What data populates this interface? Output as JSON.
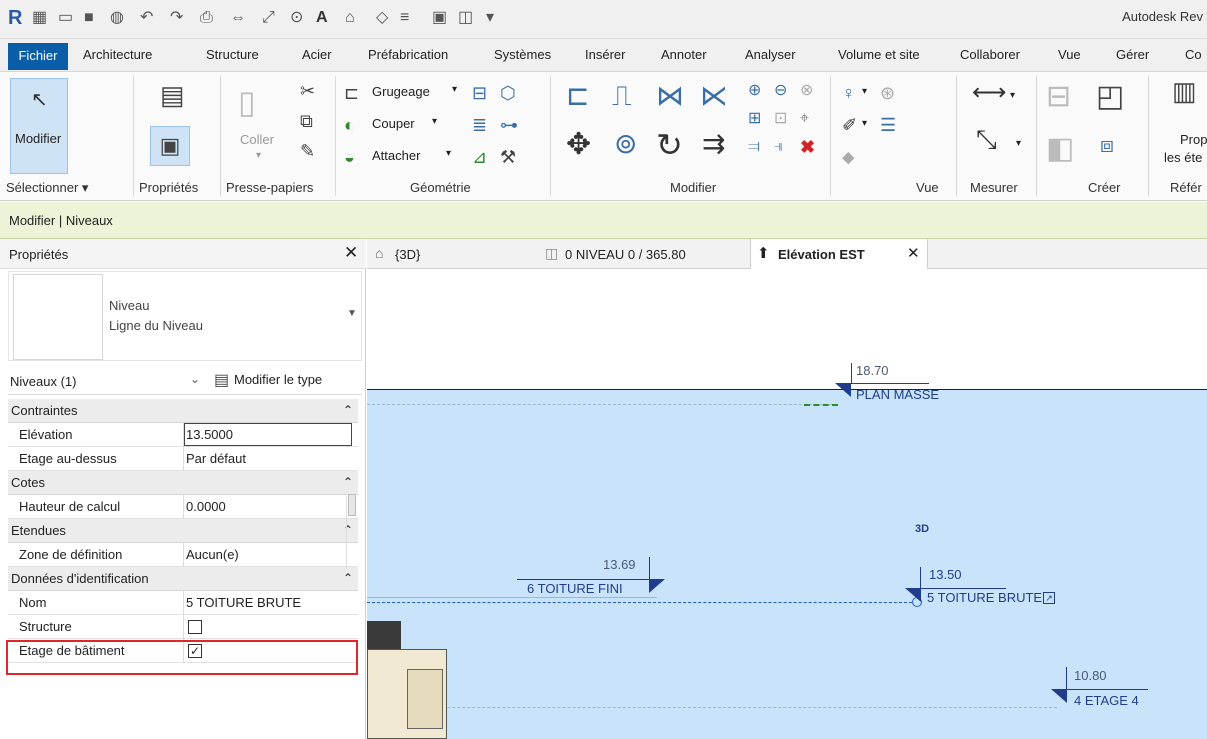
{
  "app": {
    "title": "Autodesk Rev"
  },
  "tabs": [
    "Fichier",
    "Architecture",
    "Structure",
    "Acier",
    "Préfabrication",
    "Systèmes",
    "Insérer",
    "Annoter",
    "Analyser",
    "Volume et site",
    "Collaborer",
    "Vue",
    "Gérer",
    "Co"
  ],
  "ribbon": {
    "modifier_label": "Modifier",
    "coller_label": "Coller",
    "grugeage_label": "Grugeage",
    "couper_label": "Couper",
    "attacher_label": "Attacher",
    "proprietes_label_line1": "Prop",
    "proprietes_label_line2": "les éte",
    "panels": [
      "Sélectionner ▾",
      "Propriétés",
      "Presse-papiers",
      "Géométrie",
      "Modifier",
      "Vue",
      "Mesurer",
      "Créer",
      "Référ"
    ]
  },
  "context": {
    "label": "Modifier | Niveaux"
  },
  "properties": {
    "title": "Propriétés",
    "type_line1": "Niveau",
    "type_line2": "Ligne du Niveau",
    "instance_filter": "Niveaux (1)",
    "edit_type_label": "Modifier le type",
    "categories": [
      {
        "name": "Contraintes",
        "rows": [
          {
            "name": "Elévation",
            "value": "13.5000"
          },
          {
            "name": "Etage au-dessus",
            "value": "Par défaut"
          }
        ]
      },
      {
        "name": "Cotes",
        "rows": [
          {
            "name": "Hauteur de calcul",
            "value": "0.0000"
          }
        ]
      },
      {
        "name": "Etendues",
        "rows": [
          {
            "name": "Zone de définition",
            "value": "Aucun(e)"
          }
        ]
      },
      {
        "name": "Données d'identification",
        "rows": [
          {
            "name": "Nom",
            "value": "5 TOITURE BRUTE"
          },
          {
            "name": "Structure",
            "value": ""
          },
          {
            "name": "Etage de bâtiment",
            "value": ""
          }
        ]
      }
    ]
  },
  "view_tabs": [
    "{3D}",
    "0 NIVEAU 0 / 365.80",
    "Elévation EST"
  ],
  "view": {
    "label_3d": "3D",
    "levels": [
      {
        "elevation": "18.70",
        "name": "PLAN MASSE"
      },
      {
        "elevation": "13.69",
        "name": "6 TOITURE FINI"
      },
      {
        "elevation": "13.50",
        "name": "5 TOITURE BRUTE"
      },
      {
        "elevation": "10.80",
        "name": "4 ETAGE 4"
      }
    ]
  },
  "colors": {
    "file_tab": "#0a5ea8",
    "context_bar": "#ecf3d7",
    "highlight": "#e0262a",
    "sky": "#c9e4fa",
    "level_text": "#1f3d8a"
  }
}
